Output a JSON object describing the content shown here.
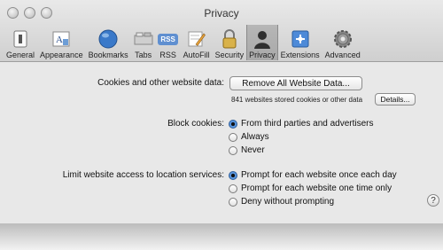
{
  "window": {
    "title": "Privacy"
  },
  "toolbar": {
    "items": [
      {
        "label": "General",
        "icon": "switch-icon"
      },
      {
        "label": "Appearance",
        "icon": "font-icon"
      },
      {
        "label": "Bookmarks",
        "icon": "globe-icon"
      },
      {
        "label": "Tabs",
        "icon": "tabs-icon"
      },
      {
        "label": "RSS",
        "icon": "rss-icon"
      },
      {
        "label": "AutoFill",
        "icon": "pencil-icon"
      },
      {
        "label": "Security",
        "icon": "lock-icon"
      },
      {
        "label": "Privacy",
        "icon": "person-icon"
      },
      {
        "label": "Extensions",
        "icon": "puzzle-icon"
      },
      {
        "label": "Advanced",
        "icon": "gear-icon"
      }
    ],
    "selected": "Privacy",
    "rss_badge": "RSS"
  },
  "cookies": {
    "label": "Cookies and other website data:",
    "remove_button": "Remove All Website Data...",
    "stored_text": "841 websites stored cookies or other data",
    "details_button": "Details..."
  },
  "block_cookies": {
    "label": "Block cookies:",
    "options": [
      "From third parties and advertisers",
      "Always",
      "Never"
    ],
    "selected_index": 0
  },
  "location": {
    "label": "Limit website access to location services:",
    "options": [
      "Prompt for each website once each day",
      "Prompt for each website one time only",
      "Deny without prompting"
    ],
    "selected_index": 0
  },
  "help": {
    "symbol": "?"
  },
  "colors": {
    "selected_radio": "#3c7fd1",
    "titlebar": "#cfcfcf",
    "background": "#e8e8e8"
  }
}
